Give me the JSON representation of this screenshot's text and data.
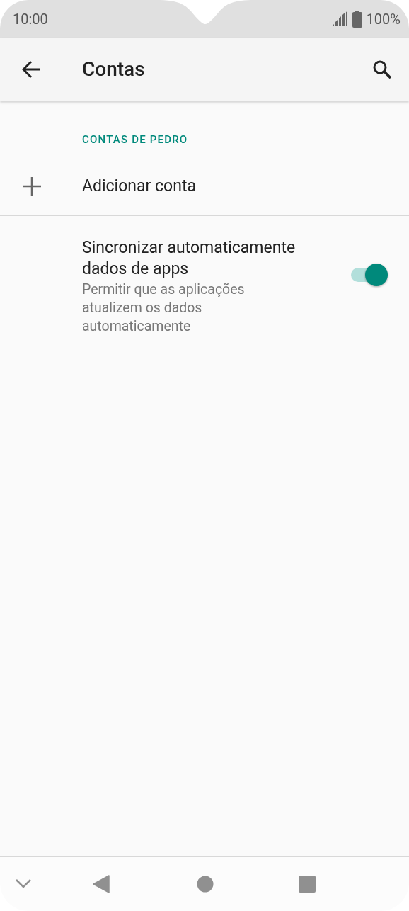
{
  "status_bar": {
    "time": "10:00",
    "battery": "100%"
  },
  "app_bar": {
    "title": "Contas"
  },
  "section": {
    "header": "CONTAS DE PEDRO"
  },
  "add_account": {
    "label": "Adicionar conta"
  },
  "sync_setting": {
    "title": "Sincronizar automaticamente dados de apps",
    "summary": "Permitir que as aplicações atualizem os dados automaticamente",
    "on": true
  }
}
